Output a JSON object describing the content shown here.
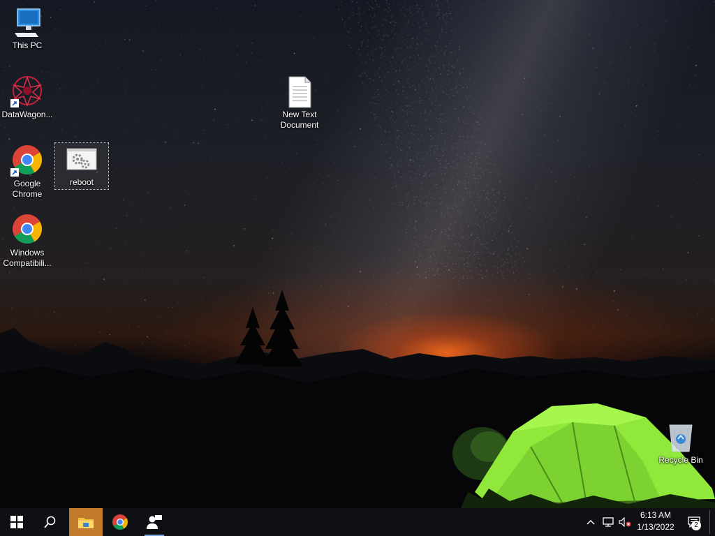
{
  "desktop_icons": {
    "this_pc": "This PC",
    "datawagon": "DataWagon...",
    "chrome": [
      "Google",
      "Chrome"
    ],
    "windows_compat": [
      "Windows",
      "Compatibili..."
    ],
    "reboot": "reboot",
    "new_text": [
      "New Text",
      "Document"
    ],
    "recycle_bin": "Recycle Bin"
  },
  "taskbar": {
    "clock_time": "6:13 AM",
    "clock_date": "1/13/2022",
    "notification_count": "2",
    "icons": [
      "windows-start-icon",
      "search-icon",
      "file-explorer-icon",
      "chrome-icon",
      "people-icon"
    ]
  },
  "colors": {
    "taskbar_bg": "#0f1014",
    "active_underline": "#7aa6d8",
    "tent_green": "#8fe83a"
  }
}
